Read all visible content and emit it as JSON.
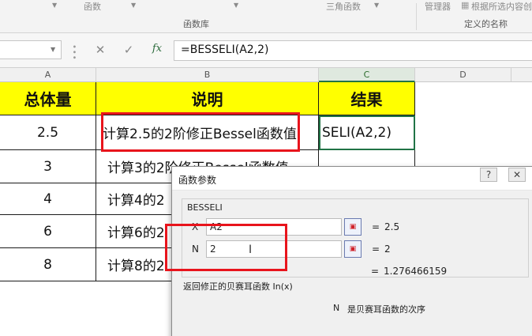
{
  "ribbon": {
    "tab_func": "函数",
    "tab_trig": "三角函数",
    "tab_mgr": "管理器",
    "tab_create": "根据所选内容创",
    "group_lib": "函数库",
    "group_names": "定义的名称"
  },
  "formula_bar": {
    "cancel_icon": "✕",
    "enter_icon": "✓",
    "fx_icon": "fx",
    "formula": "=BESSELI(A2,2)"
  },
  "columns": [
    "A",
    "B",
    "C",
    "D"
  ],
  "table": {
    "headers": [
      "总体量",
      "说明",
      "结果"
    ],
    "rows": [
      {
        "a": "2.5",
        "b": "计算2.5的2阶修正Bessel函数值",
        "c": "SELI(A2,2)"
      },
      {
        "a": "3",
        "b": "计算3的2阶修正Bessel函数值",
        "c": ""
      },
      {
        "a": "4",
        "b": "计算4的2",
        "c": ""
      },
      {
        "a": "6",
        "b": "计算6的2",
        "c": ""
      },
      {
        "a": "8",
        "b": "计算8的2",
        "c": ""
      }
    ]
  },
  "dialog": {
    "title": "函数参数",
    "help_label": "?",
    "close_label": "✕",
    "function_name": "BESSELI",
    "args": [
      {
        "label": "X",
        "value": "A2",
        "result": "2.5"
      },
      {
        "label": "N",
        "value": "2",
        "result": "2"
      }
    ],
    "eq_sign": "=",
    "formula_result": "1.276466159",
    "description": "返回修正的贝赛耳函数 In(x)",
    "arg_help_name": "N",
    "arg_help_text": "是贝赛耳函数的次序"
  },
  "colors": {
    "header_fill": "#ffff00",
    "highlight_red": "#e8141c",
    "active_green": "#217346"
  }
}
